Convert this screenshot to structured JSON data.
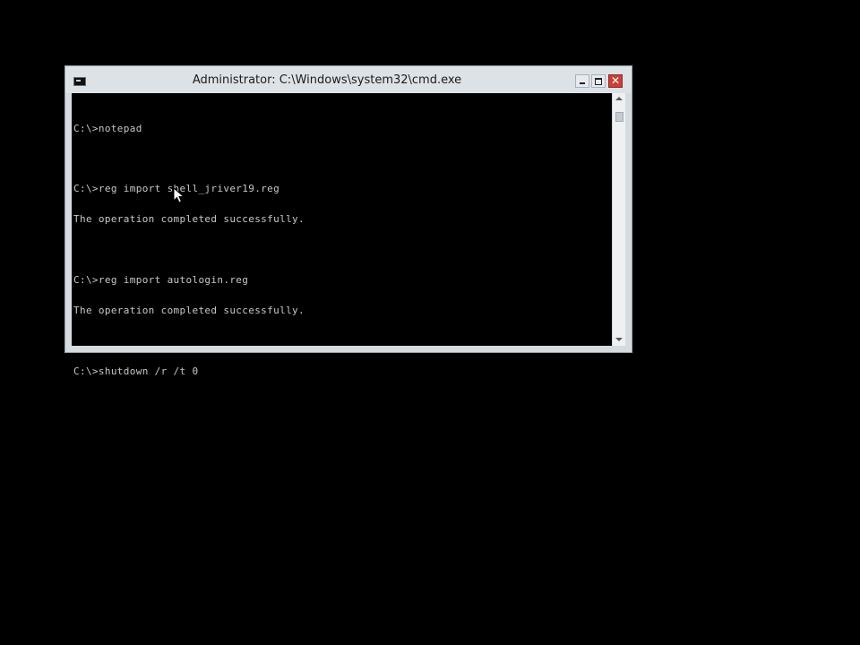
{
  "window": {
    "title": "Administrator: C:\\Windows\\system32\\cmd.exe",
    "controls": {
      "minimize_icon": "minimize-icon",
      "maximize_icon": "maximize-icon",
      "close_label": "✕"
    }
  },
  "console": {
    "lines": [
      "C:\\>notepad",
      "",
      "C:\\>reg import shell_jriver19.reg",
      "The operation completed successfully.",
      "",
      "C:\\>reg import autologin.reg",
      "The operation completed successfully.",
      "",
      "C:\\>shutdown /r /t 0"
    ]
  },
  "colors": {
    "console_background": "#000000",
    "console_text": "#c8c8c8",
    "title_bar": "#dde2e7",
    "close_button": "#c7413a"
  }
}
